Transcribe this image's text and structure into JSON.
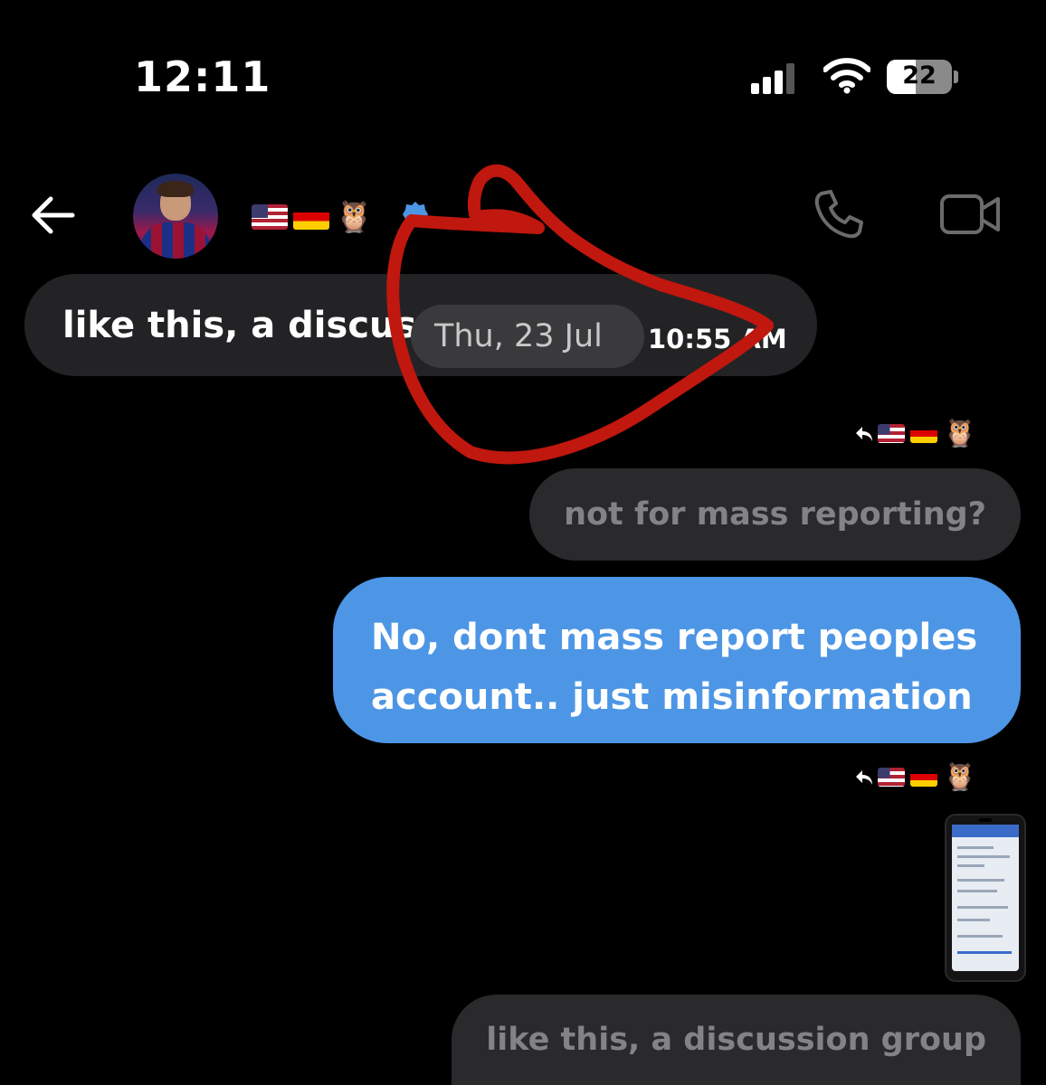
{
  "status_bar": {
    "time": "12:11",
    "battery_level": "22",
    "signal_bars_filled": 3,
    "signal_bars_total": 4
  },
  "header": {
    "back_icon": "arrow-left-icon",
    "flag_emojis": [
      "🇺🇸",
      "🇩🇪"
    ],
    "owl_emoji": "🦉",
    "verified_icon": "verified-badge-icon",
    "call_icon": "phone-icon",
    "video_icon": "video-camera-icon"
  },
  "messages": {
    "received_1": "like this, a discus",
    "date_separator": "Thu, 23 Jul",
    "received_1_time": "10:55 AM",
    "reply_meta_1_owl": "🦉",
    "sent_1": "not for mass reporting?",
    "sent_2": "No, dont mass report peoples account.. just misinformation",
    "reply_meta_2_owl": "🦉",
    "sent_3": "like this, a discussion group"
  },
  "colors": {
    "background": "#000000",
    "received_bubble": "#232326",
    "sent_blue": "#4d96e6",
    "sent_grey": "#2a2a2d",
    "annotation_red": "#c0170e"
  }
}
